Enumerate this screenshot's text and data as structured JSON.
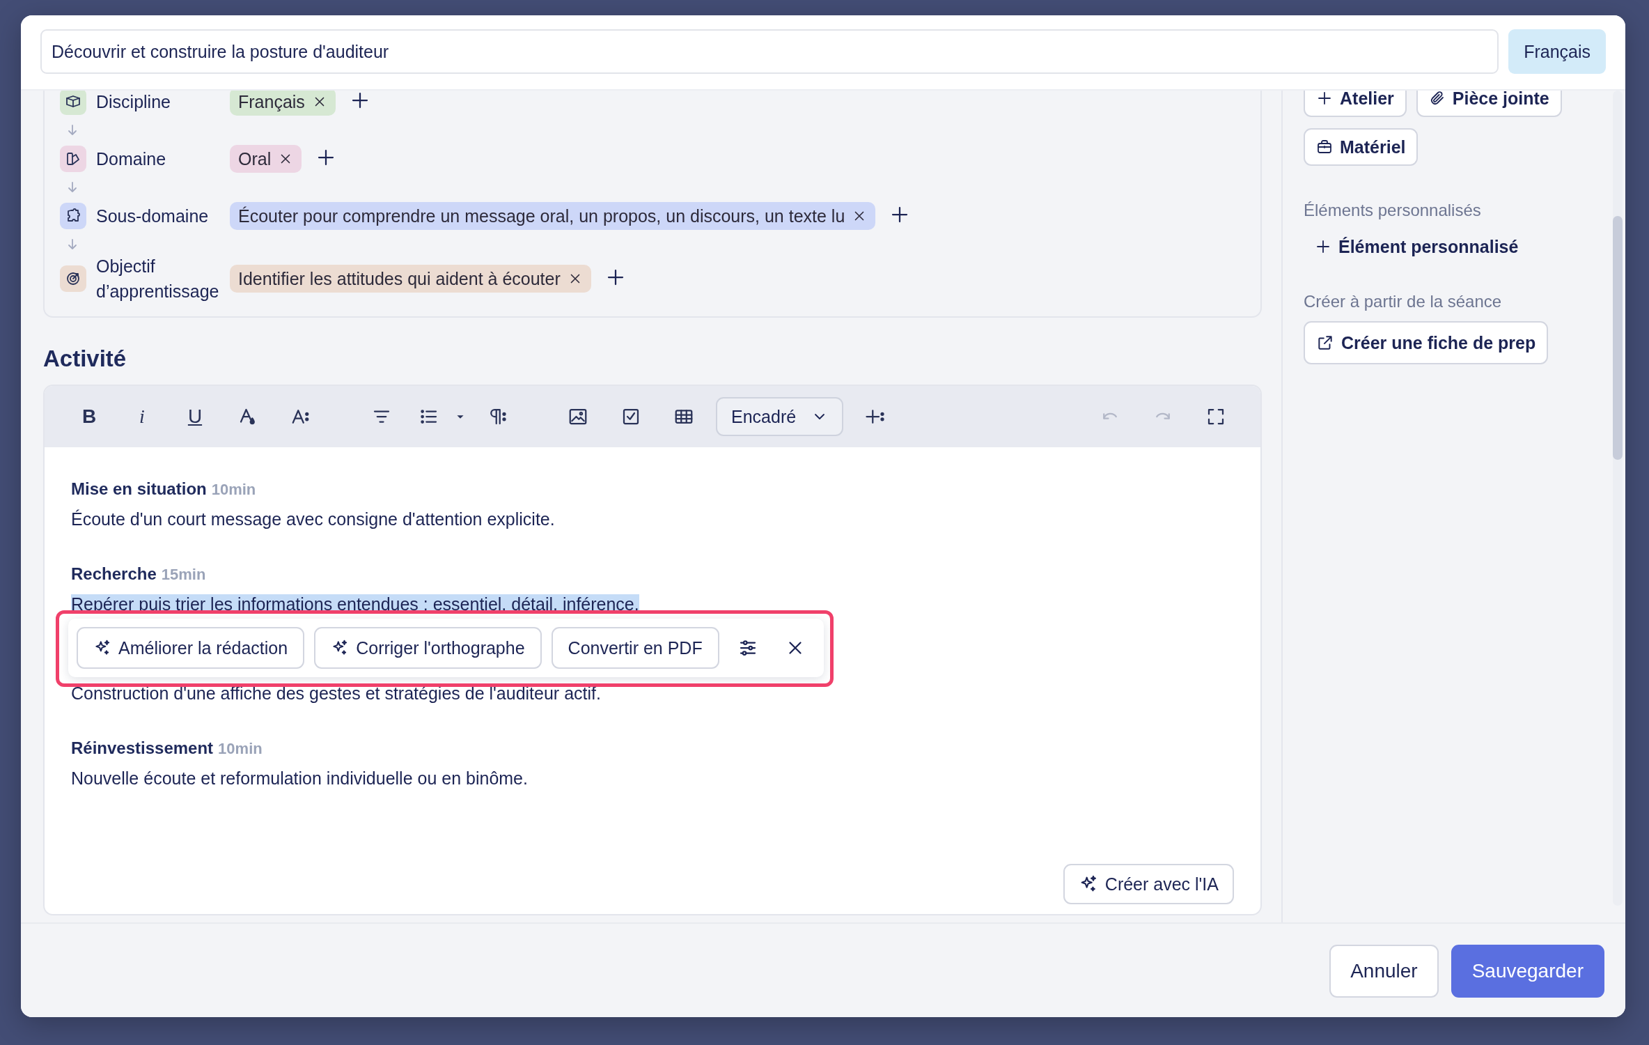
{
  "title_field": {
    "value": "Découvrir et construire la posture d'auditeur"
  },
  "language_button": "Français",
  "taxonomy": [
    {
      "kind": "discipline",
      "label": "Discipline",
      "tag": "Français",
      "color": "#d6e8d3"
    },
    {
      "kind": "domain",
      "label": "Domaine",
      "tag": "Oral",
      "color": "#edd6e4"
    },
    {
      "kind": "subdomain",
      "label": "Sous-domaine",
      "tag": "Écouter pour comprendre un message oral, un propos, un discours, un texte lu",
      "color": "#cdd7f8"
    },
    {
      "kind": "objective",
      "label": "Objectif d’apprentissage",
      "tag": "Identifier les attitudes qui aident à écouter",
      "color": "#ecdcd2"
    }
  ],
  "activity": {
    "heading": "Activité",
    "toolbar": {
      "format_buttons": [
        "B",
        "i",
        "U"
      ],
      "block_style": "Encadré",
      "undo_disabled": true,
      "redo_disabled": true
    },
    "blocks": [
      {
        "kind": "heading",
        "title": "Mise en situation",
        "duration": "10min"
      },
      {
        "kind": "text",
        "text": "Écoute d'un court message avec consigne d'attention explicite.",
        "selected": false
      },
      {
        "kind": "heading",
        "title": "Recherche",
        "duration": "15min"
      },
      {
        "kind": "text",
        "text": "Repérer puis trier les informations entendues : essentiel, détail, inférence.",
        "selected": true
      },
      {
        "kind": "text",
        "text": "Construction d'une affiche des gestes et stratégies de l'auditeur actif.",
        "selected": false
      },
      {
        "kind": "heading",
        "title": "Réinvestissement",
        "duration": "10min"
      },
      {
        "kind": "text",
        "text": "Nouvelle écoute et reformulation individuelle ou en binôme.",
        "selected": false
      }
    ],
    "selection_toolbar": {
      "actions": [
        {
          "kind": "ai",
          "label": "Améliorer la rédaction"
        },
        {
          "kind": "ai",
          "label": "Corriger l'orthographe"
        },
        {
          "kind": "plain",
          "label": "Convertir en PDF"
        }
      ]
    },
    "create_ai_button": "Créer avec l'IA"
  },
  "sidebar": {
    "buttons": [
      {
        "kind": "add",
        "label": "Atelier"
      },
      {
        "kind": "attach",
        "label": "Pièce jointe"
      },
      {
        "kind": "bag",
        "label": "Matériel"
      }
    ],
    "custom_heading": "Éléments personnalisés",
    "custom_add": "Élément personnalisé",
    "create_heading": "Créer à partir de la séance",
    "create_button": "Créer une fiche de prep"
  },
  "footer": {
    "cancel": "Annuler",
    "save": "Sauvegarder"
  }
}
